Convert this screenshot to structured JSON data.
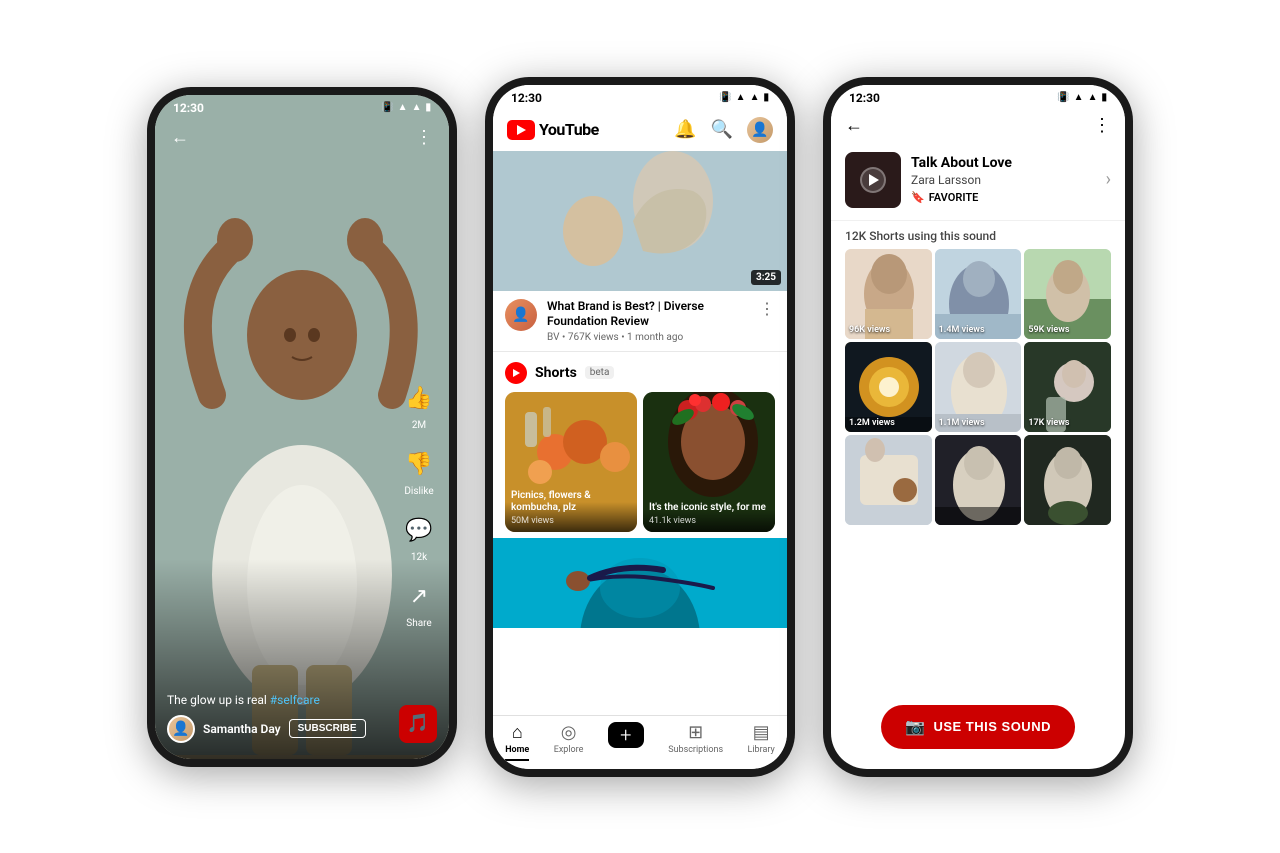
{
  "phone1": {
    "status": {
      "time": "12:30"
    },
    "caption": "The glow up is real",
    "hashtag": "#selfcare",
    "username": "Samantha Day",
    "subscribe_label": "SUBSCRIBE",
    "like_count": "2M",
    "dislike_label": "Dislike",
    "comment_count": "12k",
    "share_label": "Share"
  },
  "phone2": {
    "status": {
      "time": "12:30"
    },
    "yt_logo_text": "YouTube",
    "video_title": "What Brand is Best? | Diverse Foundation Review",
    "video_channel": "BV",
    "video_views": "767K views",
    "video_age": "1 month ago",
    "duration": "3:25",
    "shorts_title": "Shorts",
    "shorts_beta": "beta",
    "short1_title": "Picnics, flowers & kombucha, plz",
    "short1_views": "50M views",
    "short2_title": "It's the iconic style, for me",
    "short2_views": "41.1k views",
    "nav": {
      "home": "Home",
      "explore": "Explore",
      "add": "+",
      "subscriptions": "Subscriptions",
      "library": "Library"
    }
  },
  "phone3": {
    "status": {
      "time": "12:30"
    },
    "sound_title": "Talk About Love",
    "sound_artist": "Zara Larsson",
    "favorite_label": "FAVORITE",
    "sound_count": "12K Shorts using this sound",
    "videos": [
      {
        "views": "96K views"
      },
      {
        "views": "1.4M views"
      },
      {
        "views": "59K views"
      },
      {
        "views": "1.2M views"
      },
      {
        "views": "1.1M views"
      },
      {
        "views": "17K views"
      },
      {
        "views": ""
      },
      {
        "views": ""
      },
      {
        "views": ""
      }
    ],
    "use_sound_label": "USE THIS SOUND"
  }
}
